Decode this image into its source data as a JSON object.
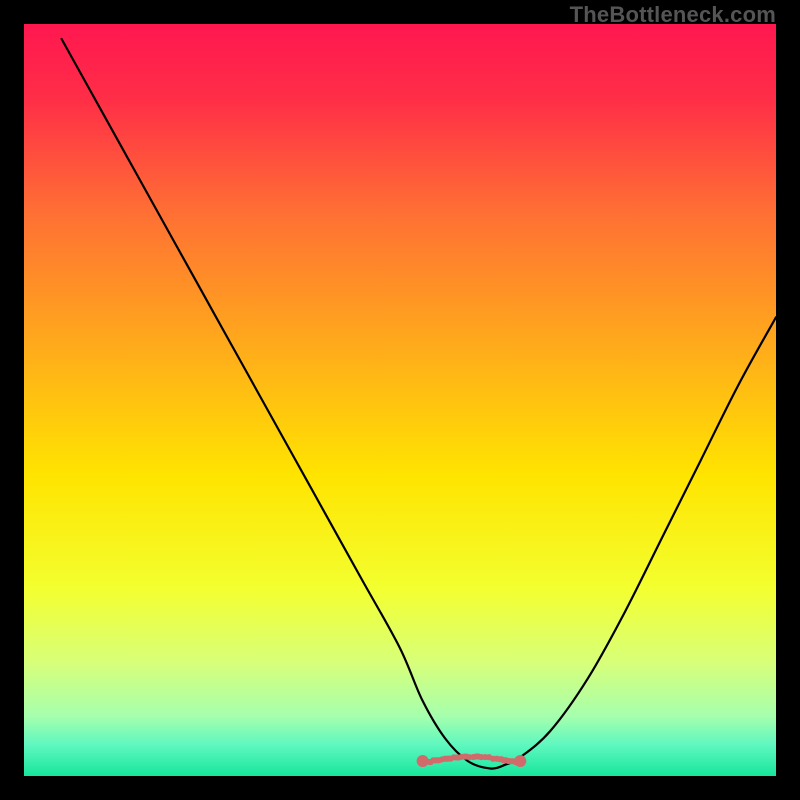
{
  "watermark": "TheBottleneck.com",
  "chart_data": {
    "type": "line",
    "title": "",
    "xlabel": "",
    "ylabel": "",
    "xlim": [
      0,
      100
    ],
    "ylim": [
      0,
      100
    ],
    "series": [
      {
        "name": "curve",
        "x": [
          5,
          10,
          15,
          20,
          25,
          30,
          35,
          40,
          45,
          50,
          53,
          56,
          59,
          62,
          64,
          66,
          70,
          75,
          80,
          85,
          90,
          95,
          100
        ],
        "y": [
          98,
          89,
          80,
          71,
          62,
          53,
          44,
          35,
          26,
          17,
          10,
          5,
          2,
          1,
          1.5,
          2.5,
          6,
          13,
          22,
          32,
          42,
          52,
          61
        ]
      }
    ],
    "marker_band": {
      "name": "bottleneck-range",
      "color": "#d16a6a",
      "x_start": 53,
      "x_end": 66,
      "y": 2
    },
    "gradient_stops": [
      {
        "offset": 0.0,
        "color": "#ff1750"
      },
      {
        "offset": 0.1,
        "color": "#ff2e47"
      },
      {
        "offset": 0.25,
        "color": "#ff6f34"
      },
      {
        "offset": 0.45,
        "color": "#ffb218"
      },
      {
        "offset": 0.6,
        "color": "#ffe400"
      },
      {
        "offset": 0.75,
        "color": "#f3ff2f"
      },
      {
        "offset": 0.85,
        "color": "#d7ff7a"
      },
      {
        "offset": 0.92,
        "color": "#a6ffad"
      },
      {
        "offset": 0.96,
        "color": "#5cf7c0"
      },
      {
        "offset": 1.0,
        "color": "#17e69b"
      }
    ]
  }
}
